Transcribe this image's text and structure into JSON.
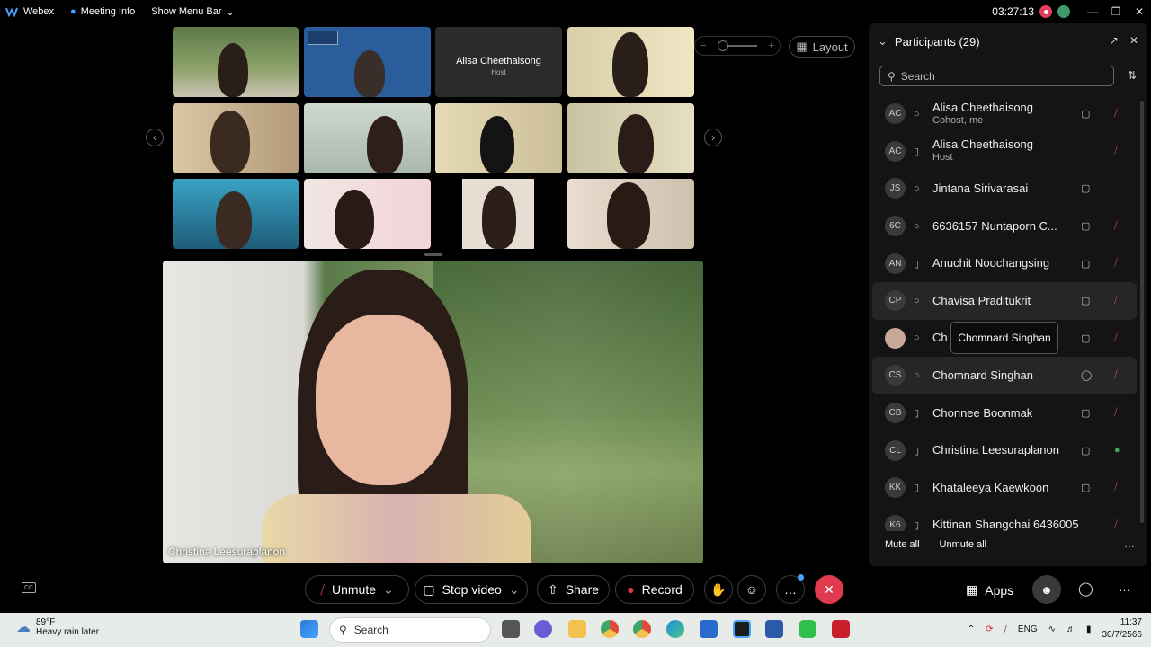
{
  "topbar": {
    "app_name": "Webex",
    "meeting_info": "Meeting Info",
    "show_menu_bar": "Show Menu Bar",
    "timer": "03:27:13"
  },
  "stage": {
    "layout_label": "Layout",
    "host_tile": {
      "name": "Alisa Cheethaisong",
      "role": "Host"
    },
    "active_speaker": "Christina Leesuraplanon"
  },
  "participants": {
    "title": "Participants (29)",
    "search_placeholder": "Search",
    "tooltip": "Chomnard Singhan",
    "mute_all": "Mute all",
    "unmute_all": "Unmute all",
    "list": [
      {
        "initials": "AC",
        "name": "Alisa Cheethaisong",
        "role": "Cohost, me",
        "device": "headset-icon",
        "cam": true,
        "mic": "muted"
      },
      {
        "initials": "AC",
        "name": "Alisa Cheethaisong",
        "role": "Host",
        "device": "phone-icon",
        "cam": false,
        "mic": "muted"
      },
      {
        "initials": "JS",
        "name": "Jintana Sirivarasai",
        "role": "",
        "device": "headset-icon",
        "cam": true,
        "mic": "none"
      },
      {
        "initials": "6C",
        "name": "6636157 Nuntaporn C...",
        "role": "",
        "device": "headset-icon",
        "cam": true,
        "mic": "muted"
      },
      {
        "initials": "AN",
        "name": "Anuchit Noochangsing",
        "role": "",
        "device": "phone-icon",
        "cam": true,
        "mic": "muted"
      },
      {
        "initials": "CP",
        "name": "Chavisa Praditukrit",
        "role": "",
        "device": "headset-icon",
        "cam": true,
        "mic": "muted"
      },
      {
        "initials": "",
        "name": "Ch",
        "role": "",
        "device": "headset-icon",
        "cam": true,
        "mic": "muted"
      },
      {
        "initials": "CS",
        "name": "Chomnard Singhan",
        "role": "",
        "device": "headset-icon",
        "cam": false,
        "mic": "muted"
      },
      {
        "initials": "CB",
        "name": "Chonnee Boonmak",
        "role": "",
        "device": "phone-icon",
        "cam": true,
        "mic": "muted"
      },
      {
        "initials": "CL",
        "name": "Christina Leesuraplanon",
        "role": "",
        "device": "phone-icon",
        "cam": true,
        "mic": "on"
      },
      {
        "initials": "KK",
        "name": "Khataleeya Kaewkoon",
        "role": "",
        "device": "phone-icon",
        "cam": true,
        "mic": "muted"
      },
      {
        "initials": "K6",
        "name": "Kittinan Shangchai 6436005",
        "role": "",
        "device": "phone-icon",
        "cam": false,
        "mic": "muted"
      }
    ]
  },
  "controls": {
    "unmute": "Unmute",
    "stop_video": "Stop video",
    "share": "Share",
    "record": "Record",
    "apps": "Apps"
  },
  "taskbar": {
    "temperature": "89°F",
    "forecast": "Heavy rain later",
    "search": "Search",
    "language": "ENG",
    "time": "11:37",
    "date": "30/7/2566"
  }
}
